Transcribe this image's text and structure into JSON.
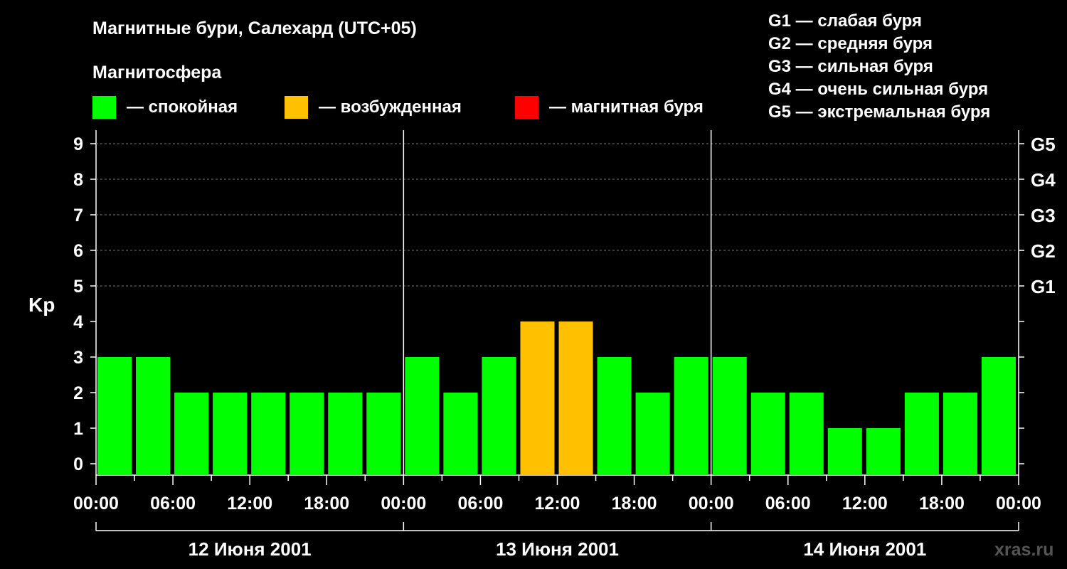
{
  "title": "Магнитные бури, Салехард (UTC+05)",
  "magnetosphere_label": "Магнитосфера",
  "colors": {
    "quiet": "#00ff00",
    "disturbed": "#ffc000",
    "storm": "#ff0000",
    "background": "#000000",
    "text": "#ffffff"
  },
  "legend": [
    {
      "key": "quiet",
      "label": "— спокойная"
    },
    {
      "key": "disturbed",
      "label": "— возбужденная"
    },
    {
      "key": "storm",
      "label": "— магнитная буря"
    }
  ],
  "storm_levels": [
    "G1 — слабая буря",
    "G2 — средняя буря",
    "G3 — сильная буря",
    "G4 — очень сильная буря",
    "G5 — экстремальная буря"
  ],
  "watermark": "xras.ru",
  "chart_data": {
    "type": "bar",
    "ylabel": "Kp",
    "ylim": [
      0,
      9
    ],
    "y_ticks": [
      "0",
      "1",
      "2",
      "3",
      "4",
      "5",
      "6",
      "7",
      "8",
      "9"
    ],
    "right_axis_ticks": [
      {
        "kp": 5,
        "label": "G1"
      },
      {
        "kp": 6,
        "label": "G2"
      },
      {
        "kp": 7,
        "label": "G3"
      },
      {
        "kp": 8,
        "label": "G4"
      },
      {
        "kp": 9,
        "label": "G5"
      }
    ],
    "grid": "horizontal dashed",
    "x_tick_labels": [
      "00:00",
      "06:00",
      "12:00",
      "18:00",
      "00:00",
      "06:00",
      "12:00",
      "18:00",
      "00:00",
      "06:00",
      "12:00",
      "18:00",
      "00:00"
    ],
    "days": [
      "12 Июня 2001",
      "13 Июня 2001",
      "14 Июня 2001"
    ],
    "hours_per_bar": 3,
    "bars": [
      {
        "start": "12 Июня 2001 00:00",
        "kp": 3,
        "level": "quiet"
      },
      {
        "start": "12 Июня 2001 03:00",
        "kp": 3,
        "level": "quiet"
      },
      {
        "start": "12 Июня 2001 06:00",
        "kp": 2,
        "level": "quiet"
      },
      {
        "start": "12 Июня 2001 09:00",
        "kp": 2,
        "level": "quiet"
      },
      {
        "start": "12 Июня 2001 12:00",
        "kp": 2,
        "level": "quiet"
      },
      {
        "start": "12 Июня 2001 15:00",
        "kp": 2,
        "level": "quiet"
      },
      {
        "start": "12 Июня 2001 18:00",
        "kp": 2,
        "level": "quiet"
      },
      {
        "start": "12 Июня 2001 21:00",
        "kp": 2,
        "level": "quiet"
      },
      {
        "start": "13 Июня 2001 00:00",
        "kp": 3,
        "level": "quiet"
      },
      {
        "start": "13 Июня 2001 03:00",
        "kp": 2,
        "level": "quiet"
      },
      {
        "start": "13 Июня 2001 06:00",
        "kp": 3,
        "level": "quiet"
      },
      {
        "start": "13 Июня 2001 09:00",
        "kp": 4,
        "level": "disturbed"
      },
      {
        "start": "13 Июня 2001 12:00",
        "kp": 4,
        "level": "disturbed"
      },
      {
        "start": "13 Июня 2001 15:00",
        "kp": 3,
        "level": "quiet"
      },
      {
        "start": "13 Июня 2001 18:00",
        "kp": 2,
        "level": "quiet"
      },
      {
        "start": "13 Июня 2001 21:00",
        "kp": 3,
        "level": "quiet"
      },
      {
        "start": "14 Июня 2001 00:00",
        "kp": 3,
        "level": "quiet"
      },
      {
        "start": "14 Июня 2001 03:00",
        "kp": 2,
        "level": "quiet"
      },
      {
        "start": "14 Июня 2001 06:00",
        "kp": 2,
        "level": "quiet"
      },
      {
        "start": "14 Июня 2001 09:00",
        "kp": 1,
        "level": "quiet"
      },
      {
        "start": "14 Июня 2001 12:00",
        "kp": 1,
        "level": "quiet"
      },
      {
        "start": "14 Июня 2001 15:00",
        "kp": 2,
        "level": "quiet"
      },
      {
        "start": "14 Июня 2001 18:00",
        "kp": 2,
        "level": "quiet"
      },
      {
        "start": "14 Июня 2001 21:00",
        "kp": 3,
        "level": "quiet"
      }
    ]
  }
}
